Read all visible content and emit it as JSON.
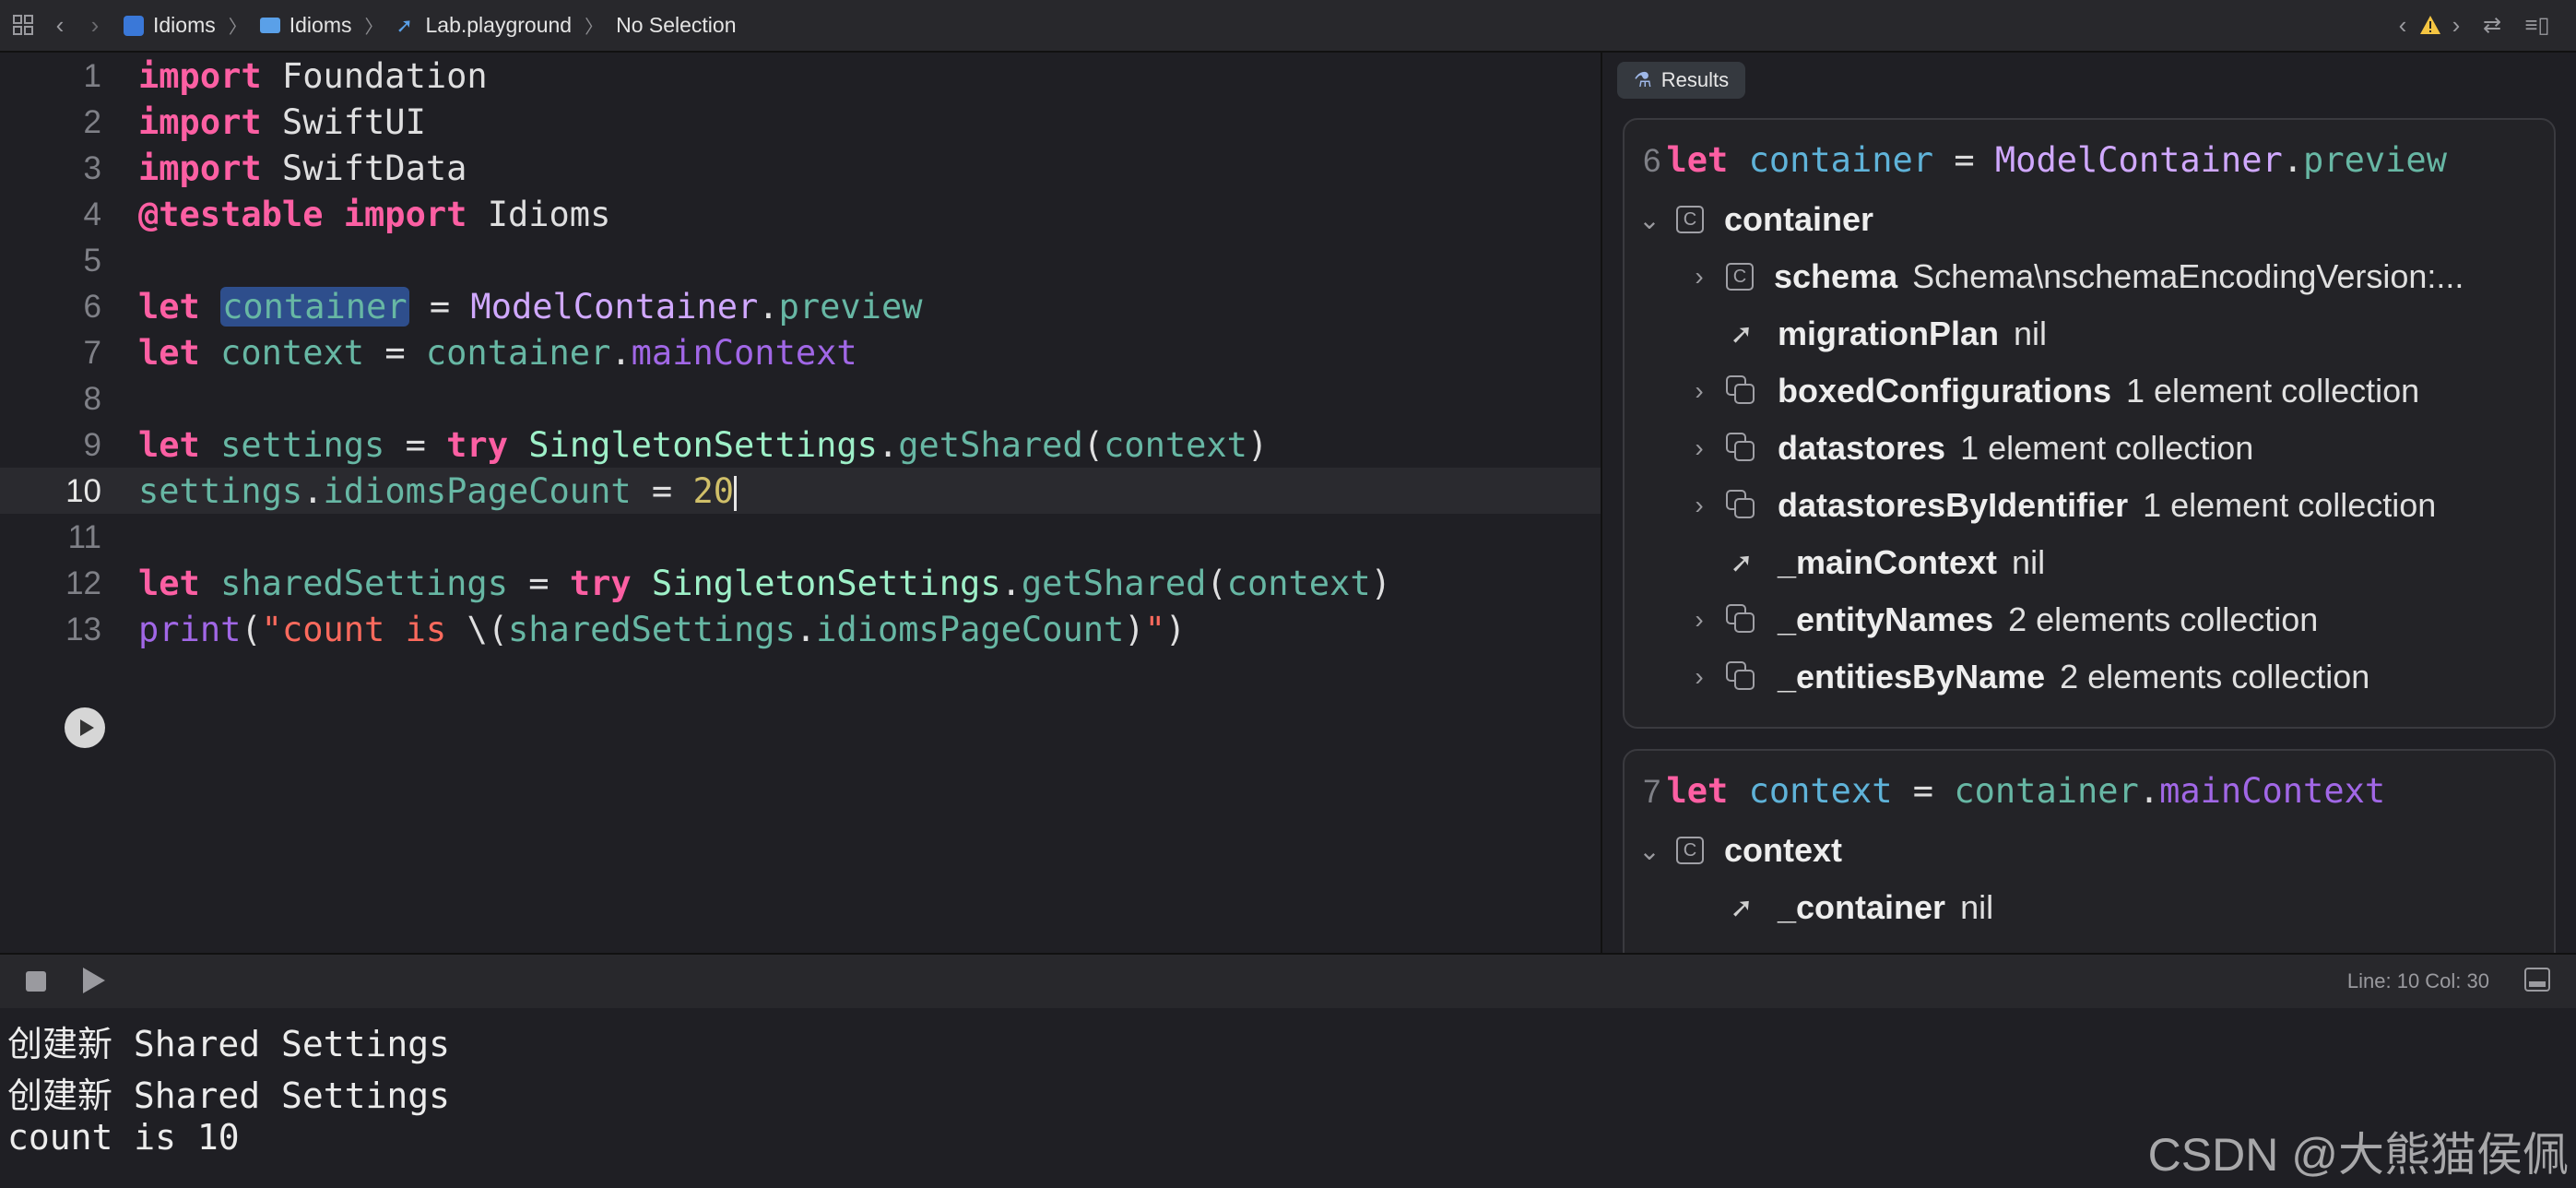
{
  "breadcrumb": {
    "items": [
      {
        "label": "Idioms",
        "icon": "app-icon"
      },
      {
        "label": "Idioms",
        "icon": "folder-icon"
      },
      {
        "label": "Lab.playground",
        "icon": "swift-icon"
      },
      {
        "label": "No Selection",
        "icon": ""
      }
    ]
  },
  "editor": {
    "line_numbers": [
      "1",
      "2",
      "3",
      "4",
      "5",
      "6",
      "7",
      "8",
      "9",
      "10",
      "11",
      "12",
      "13"
    ],
    "current_line": "10"
  },
  "results": {
    "tab_label": "Results",
    "card1": {
      "line": "6",
      "root": {
        "name": "container"
      },
      "rows": [
        {
          "name": "schema",
          "value": "Schema\\nschemaEncodingVersion:..."
        },
        {
          "name": "migrationPlan",
          "value": "nil"
        },
        {
          "name": "boxedConfigurations",
          "value": "1 element collection"
        },
        {
          "name": "datastores",
          "value": "1 element collection"
        },
        {
          "name": "datastoresByIdentifier",
          "value": "1 element collection"
        },
        {
          "name": "_mainContext",
          "value": "nil"
        },
        {
          "name": "_entityNames",
          "value": "2 elements collection"
        },
        {
          "name": "_entitiesByName",
          "value": "2 elements collection"
        }
      ]
    },
    "card2": {
      "line": "7",
      "root": {
        "name": "context"
      },
      "rows": [
        {
          "name": "_container",
          "value": "nil"
        }
      ]
    }
  },
  "status": {
    "line_col": "Line: 10  Col: 30"
  },
  "console": {
    "lines": [
      "创建新 Shared Settings",
      "创建新 Shared Settings",
      "count is 10"
    ]
  },
  "watermark": "CSDN @大熊猫侯佩",
  "colors": {
    "keyword": "#fc5fa3",
    "variable": "#67b7a4",
    "type": "#d0a8ff",
    "property": "#a167e6",
    "number": "#d0bf69",
    "string": "#fc6a5d",
    "selection": "#2e4e8c",
    "warning": "#f5c542"
  }
}
